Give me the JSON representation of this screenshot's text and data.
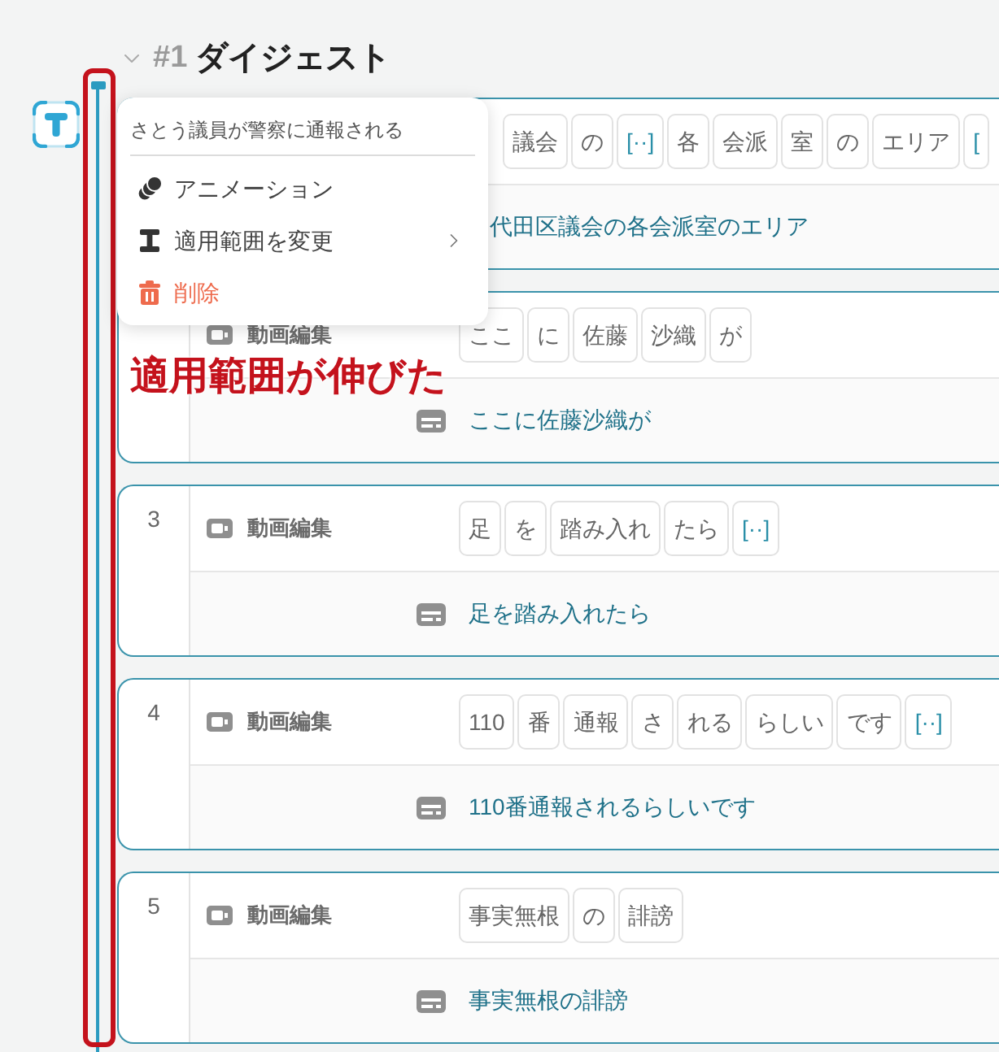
{
  "header": {
    "number": "#1",
    "title": "ダイジェスト",
    "expanded": true
  },
  "context_menu": {
    "title": "さとう議員が警察に通報される",
    "items": [
      {
        "kind": "animation",
        "label": "アニメーション",
        "submenu": false,
        "danger": false
      },
      {
        "kind": "range",
        "label": "適用範囲を変更",
        "submenu": true,
        "danger": false
      },
      {
        "kind": "delete",
        "label": "削除",
        "submenu": false,
        "danger": true
      }
    ]
  },
  "annotation": {
    "text": "適用範囲が伸びた"
  },
  "clips": [
    {
      "chips": [
        {
          "kind": "word",
          "text": "議会"
        },
        {
          "kind": "word",
          "text": "の"
        },
        {
          "kind": "marker",
          "text": "[··]"
        },
        {
          "kind": "word",
          "text": "各"
        },
        {
          "kind": "word",
          "text": "会派"
        },
        {
          "kind": "word",
          "text": "室"
        },
        {
          "kind": "word",
          "text": "の"
        },
        {
          "kind": "word",
          "text": "エリア"
        },
        {
          "kind": "marker",
          "text": "["
        }
      ],
      "subtitle": "代田区議会の各会派室のエリア"
    },
    {
      "label": "動画編集",
      "chips": [
        {
          "kind": "word",
          "text": "ここ"
        },
        {
          "kind": "word",
          "text": "に"
        },
        {
          "kind": "word",
          "text": "佐藤"
        },
        {
          "kind": "word",
          "text": "沙織"
        },
        {
          "kind": "word",
          "text": "が"
        }
      ],
      "subtitle": "ここに佐藤沙織が"
    },
    {
      "number": "3",
      "label": "動画編集",
      "chips": [
        {
          "kind": "word",
          "text": "足"
        },
        {
          "kind": "word",
          "text": "を"
        },
        {
          "kind": "word",
          "text": "踏み入れ"
        },
        {
          "kind": "word",
          "text": "たら"
        },
        {
          "kind": "marker",
          "text": "[··]"
        }
      ],
      "subtitle": "足を踏み入れたら"
    },
    {
      "number": "4",
      "label": "動画編集",
      "chips": [
        {
          "kind": "word",
          "text": "110"
        },
        {
          "kind": "word",
          "text": "番"
        },
        {
          "kind": "word",
          "text": "通報"
        },
        {
          "kind": "word",
          "text": "さ"
        },
        {
          "kind": "word",
          "text": "れる"
        },
        {
          "kind": "word",
          "text": "らしい"
        },
        {
          "kind": "word",
          "text": "です"
        },
        {
          "kind": "marker",
          "text": "[··]"
        }
      ],
      "subtitle": "110番通報されるらしいです"
    },
    {
      "number": "5",
      "label": "動画編集",
      "chips": [
        {
          "kind": "word",
          "text": "事実無根"
        },
        {
          "kind": "word",
          "text": "の"
        },
        {
          "kind": "word",
          "text": "誹謗"
        }
      ],
      "subtitle": "事実無根の誹謗"
    }
  ]
}
